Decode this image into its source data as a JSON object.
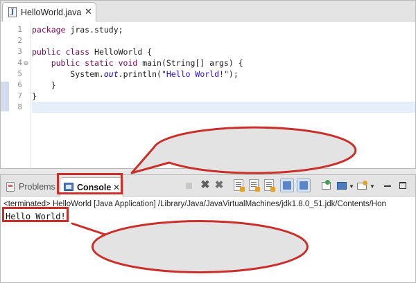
{
  "editor": {
    "tab": {
      "title": "HelloWorld.java",
      "close_icon": "close-icon"
    },
    "lines": [
      {
        "num": "1",
        "text": "package jras.study;"
      },
      {
        "num": "2",
        "text": ""
      },
      {
        "num": "3",
        "text": "public class HelloWorld {"
      },
      {
        "num": "4",
        "text": "    public static void main(String[] args) {"
      },
      {
        "num": "5",
        "text": "        System.out.println(\"Hello World!\");"
      },
      {
        "num": "6",
        "text": "    }"
      },
      {
        "num": "7",
        "text": "}"
      },
      {
        "num": "8",
        "text": ""
      }
    ],
    "current_line": "8",
    "fold_line": "4"
  },
  "views": {
    "tabs": [
      {
        "label": "Problems",
        "icon": "problems-icon",
        "active": false
      },
      {
        "label": "Console",
        "icon": "console-icon",
        "active": true
      }
    ],
    "toolbar_icons": [
      "terminate-icon",
      "remove-launch-icon",
      "remove-all-terminated-icon",
      "scroll-lock-icon",
      "word-wrap-icon",
      "show-console-output-icon",
      "show-console-stdout-icon",
      "show-console-stderr-icon",
      "pin-console-icon",
      "display-selected-console-icon",
      "open-console-icon",
      "minimize-icon",
      "maximize-icon"
    ]
  },
  "console": {
    "terminated_text": "<terminated> HelloWorld [Java Application] /Library/Java/JavaVirtualMachines/jdk1.8.0_51.jdk/Contents/Hon",
    "output": "Hello World!"
  },
  "annotations": {
    "highlight_color": "#c9302c",
    "bubble_fill": "#e3e3e3"
  }
}
